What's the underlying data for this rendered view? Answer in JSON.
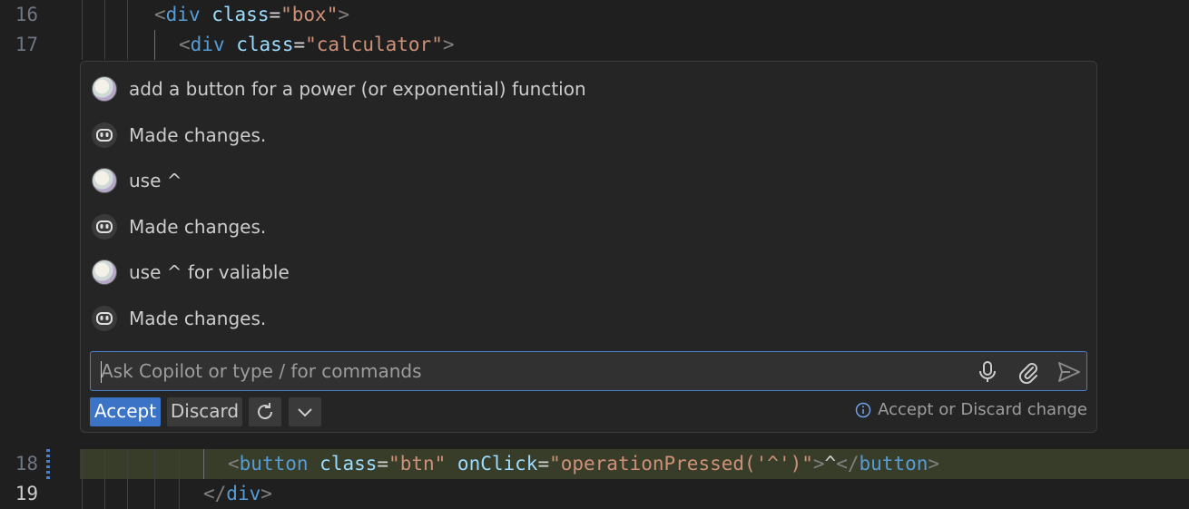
{
  "editor": {
    "lines": {
      "l16": {
        "number": "16",
        "open": "<",
        "tag": "div",
        "attr": "class",
        "eq": "=",
        "value": "\"box\"",
        "close": ">"
      },
      "l17": {
        "number": "17",
        "open": "<",
        "tag": "div",
        "attr": "class",
        "eq": "=",
        "value": "\"calculator\"",
        "close": ">"
      },
      "l18": {
        "number": "18",
        "open": "<",
        "tag": "button",
        "attr1": "class",
        "eq1": "=",
        "value1": "\"btn\"",
        "attr2": "onClick",
        "eq2": "=",
        "value2": "\"operationPressed('^')\"",
        "close": ">",
        "text": "^",
        "end_open": "</",
        "end_tag": "button",
        "end_close": ">"
      },
      "l19": {
        "number": "19",
        "end_open": "</",
        "end_tag": "div",
        "end_close": ">"
      }
    }
  },
  "chat": {
    "messages": [
      {
        "role": "user",
        "avatar_icon": "user-avatar",
        "text": "add a button for a power (or exponential) function"
      },
      {
        "role": "copilot",
        "avatar_icon": "copilot-icon",
        "text": "Made changes."
      },
      {
        "role": "user",
        "avatar_icon": "user-avatar",
        "text": "use ^"
      },
      {
        "role": "copilot",
        "avatar_icon": "copilot-icon",
        "text": "Made changes."
      },
      {
        "role": "user",
        "avatar_icon": "user-avatar",
        "text": "use ^ for valiable"
      },
      {
        "role": "copilot",
        "avatar_icon": "copilot-icon",
        "text": "Made changes."
      }
    ],
    "input": {
      "value": "",
      "placeholder": "Ask Copilot or type / for commands"
    },
    "input_icons": [
      "microphone-icon",
      "attach-icon",
      "send-icon"
    ],
    "actions": {
      "accept_label": "Accept",
      "discard_label": "Discard",
      "rerun_icon": "refresh-icon",
      "more_icon": "chevron-down-icon"
    },
    "status": {
      "icon": "info-icon",
      "text": "Accept or Discard change"
    }
  },
  "colors": {
    "accent": "#3b74c7",
    "added_line": "#373d29",
    "input_border": "#4a7dce"
  }
}
